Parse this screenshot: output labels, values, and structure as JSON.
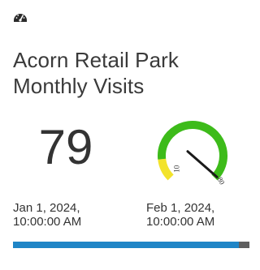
{
  "card": {
    "icon": "dashboard-gauge-icon",
    "title_line1": "Acorn Retail Park",
    "title_line2": "Monthly Visits",
    "value": "79",
    "start_date_line1": "Jan 1, 2024,",
    "start_date_line2": "10:00:00 AM",
    "end_date_line1": "Feb 1, 2024,",
    "end_date_line2": "10:00:00 AM"
  },
  "gauge": {
    "min_label": "10",
    "max_label": "80",
    "value": 79,
    "min": 10,
    "max": 80,
    "bands": [
      {
        "from": 10,
        "to": 20,
        "color": "#f2e32b"
      },
      {
        "from": 20,
        "to": 80,
        "color": "#3dbb1a"
      }
    ]
  },
  "colors": {
    "progress_fill": "#1f85c6",
    "progress_track": "#5f5f5f",
    "needle": "#1a1a1a"
  },
  "progress": {
    "fraction": 0.955
  }
}
